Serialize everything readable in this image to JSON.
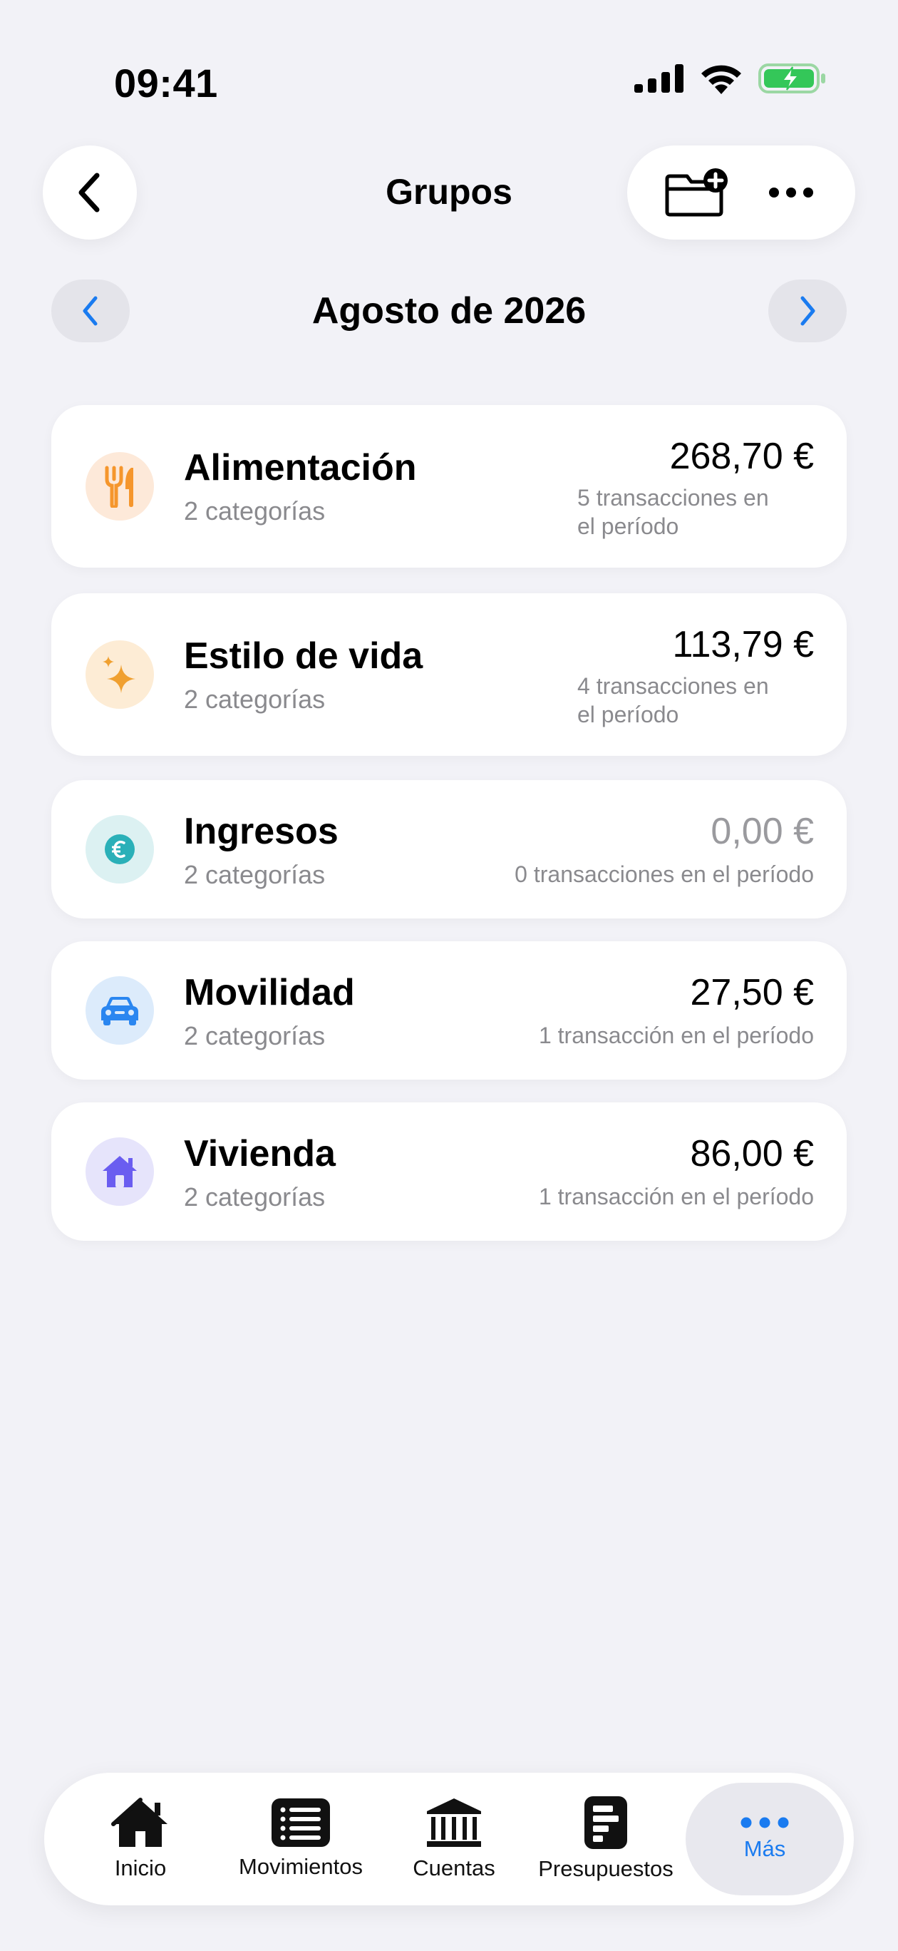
{
  "status_bar": {
    "time": "09:41"
  },
  "header": {
    "back_icon": "chevron-left-icon",
    "title": "Grupos",
    "add_folder_icon": "folder-plus-icon",
    "more_icon": "ellipsis-icon"
  },
  "period": {
    "label": "Agosto de 2026",
    "accent_color": "#1a7bf0"
  },
  "groups": [
    {
      "name": "Alimentación",
      "categories": "2 categorías",
      "amount": "268,70 €",
      "transactions_line1": "5 transacciones en",
      "transactions_line2": "el período",
      "icon": "fork-knife-icon",
      "icon_color": "#f5962c",
      "icon_bg": "#fde9d9"
    },
    {
      "name": "Estilo de vida",
      "categories": "2 categorías",
      "amount": "113,79 €",
      "transactions_line1": "4 transacciones en",
      "transactions_line2": "el período",
      "icon": "sparkles-icon",
      "icon_color": "#f0a030",
      "icon_bg": "#fdecd5"
    },
    {
      "name": "Ingresos",
      "categories": "2 categorías",
      "amount": "0,00 €",
      "transactions": "0 transacciones en el período",
      "icon": "euro-icon",
      "icon_color": "#2ab0b8",
      "icon_bg": "#dcf1f2"
    },
    {
      "name": "Movilidad",
      "categories": "2 categorías",
      "amount": "27,50 €",
      "transactions": "1 transacción en el período",
      "icon": "car-icon",
      "icon_color": "#2a86f0",
      "icon_bg": "#dcebfb"
    },
    {
      "name": "Vivienda",
      "categories": "2 categorías",
      "amount": "86,00 €",
      "transactions": "1 transacción en el período",
      "icon": "house-icon",
      "icon_color": "#6a5df0",
      "icon_bg": "#e6e4fb"
    }
  ],
  "tabbar": {
    "tabs": [
      {
        "label": "Inicio",
        "icon": "house-icon"
      },
      {
        "label": "Movimientos",
        "icon": "list-icon"
      },
      {
        "label": "Cuentas",
        "icon": "bank-icon"
      },
      {
        "label": "Presupuestos",
        "icon": "budget-icon"
      },
      {
        "label": "Más",
        "icon": "ellipsis-icon",
        "active": true
      }
    ]
  }
}
